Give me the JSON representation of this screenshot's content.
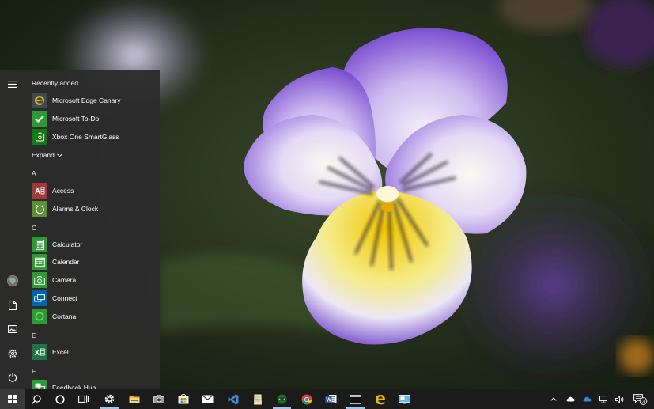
{
  "start_menu": {
    "recently_added_label": "Recently added",
    "recent_apps": [
      {
        "label": "Microsoft Edge Canary",
        "icon": "edge-canary-icon"
      },
      {
        "label": "Microsoft To-Do",
        "icon": "todo-icon"
      },
      {
        "label": "Xbox One SmartGlass",
        "icon": "xbox-smartglass-icon"
      }
    ],
    "expand_label": "Expand",
    "groups": [
      {
        "letter": "A",
        "apps": [
          {
            "label": "Access",
            "icon": "access-icon"
          },
          {
            "label": "Alarms & Clock",
            "icon": "alarm-clock-icon"
          }
        ]
      },
      {
        "letter": "C",
        "apps": [
          {
            "label": "Calculator",
            "icon": "calculator-icon"
          },
          {
            "label": "Calendar",
            "icon": "calendar-icon"
          },
          {
            "label": "Camera",
            "icon": "camera-icon"
          },
          {
            "label": "Connect",
            "icon": "connect-icon"
          },
          {
            "label": "Cortana",
            "icon": "cortana-icon"
          }
        ]
      },
      {
        "letter": "E",
        "apps": [
          {
            "label": "Excel",
            "icon": "excel-icon"
          }
        ]
      },
      {
        "letter": "F",
        "apps": [
          {
            "label": "Feedback Hub",
            "icon": "feedback-hub-icon"
          }
        ]
      }
    ],
    "rail": [
      "hamburger-menu-icon",
      "user-avatar-icon",
      "documents-icon",
      "pictures-icon",
      "settings-icon",
      "power-icon"
    ]
  },
  "taskbar": {
    "pinned": [
      "start-icon",
      "search-icon",
      "cortana-icon",
      "task-view-icon",
      "settings-icon",
      "file-explorer-icon",
      "camera-icon",
      "store-icon",
      "mail-icon",
      "visual-studio-icon",
      "notepad-icon",
      "xbox-icon",
      "chrome-icon",
      "word-icon",
      "terminal-icon",
      "edge-icon",
      "remote-desktop-icon"
    ],
    "tray": [
      "chevron-up-icon",
      "onedrive-icon",
      "onedrive-business-icon",
      "network-icon",
      "volume-icon",
      "action-center-icon"
    ],
    "notification_count": "3"
  },
  "colors": {
    "tile_blue": "#0063b1",
    "tile_green": "#2d9b34",
    "tile_access": "#a4373a",
    "tile_excel": "#217346",
    "menu_bg": "#2c2c2c",
    "taskbar_bg": "#1b1b1b"
  }
}
